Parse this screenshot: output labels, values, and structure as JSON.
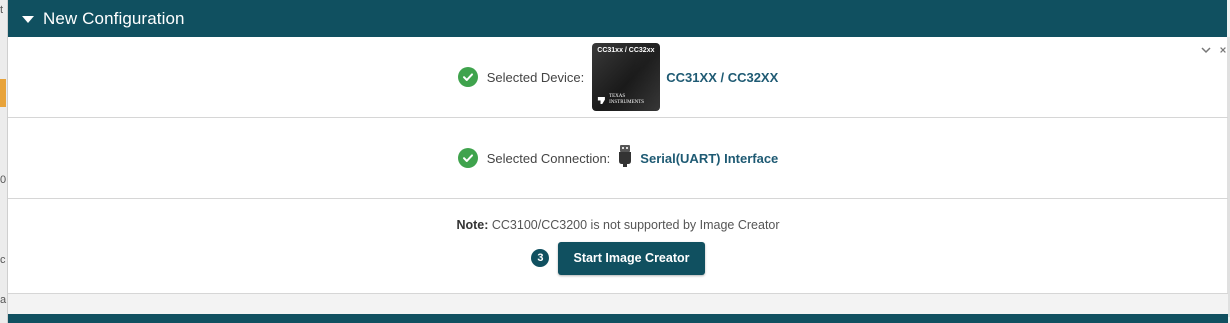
{
  "header": {
    "title": "New Configuration"
  },
  "device": {
    "label": "Selected Device:",
    "chip_caption": "CC31xx / CC32xx",
    "chip_logo": "TEXAS INSTRUMENTS",
    "value": "CC31XX / CC32XX"
  },
  "connection": {
    "label": "Selected Connection:",
    "value": "Serial(UART) Interface"
  },
  "note": {
    "prefix": "Note:",
    "text": "CC3100/CC3200 is not supported by Image Creator"
  },
  "action": {
    "step": "3",
    "button_label": "Start Image Creator"
  },
  "colors": {
    "header_bg": "#105060",
    "success": "#3fa34d",
    "link": "#1e5a73",
    "accent_orange": "#e8a33a"
  },
  "icons": {
    "caret": "caret-down-icon",
    "check": "check-circle-icon",
    "usb": "usb-connector-icon",
    "chevron": "chevron-down-icon",
    "close": "close-icon"
  },
  "backdrop": {
    "glyphs": [
      "t",
      "0",
      "c",
      "a"
    ]
  }
}
